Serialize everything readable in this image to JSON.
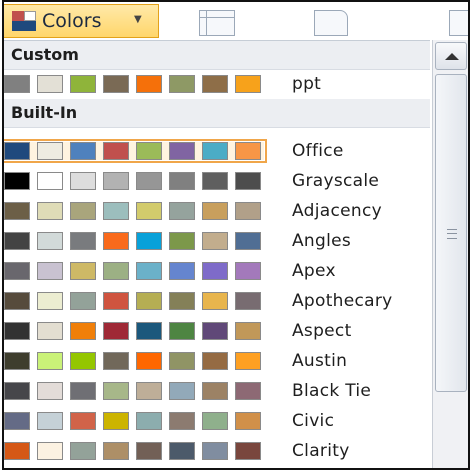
{
  "ribbon": {
    "colors_label": "Colors",
    "colors_caret": "▼"
  },
  "sections": {
    "custom": "Custom",
    "builtin": "Built-In"
  },
  "custom_themes": [
    {
      "name": "ppt",
      "colors": [
        "#808080",
        "#e3e0d6",
        "#8fb43a",
        "#7a6a55",
        "#f5700a",
        "#8e9965",
        "#8e6e48",
        "#f7a21b"
      ]
    }
  ],
  "builtin_themes": [
    {
      "name": "Office",
      "colors": [
        "#1f497d",
        "#eeece1",
        "#4f81bd",
        "#c0504d",
        "#9bbb59",
        "#8064a2",
        "#4bacc6",
        "#f79646"
      ]
    },
    {
      "name": "Grayscale",
      "colors": [
        "#000000",
        "#ffffff",
        "#dddddd",
        "#b2b2b2",
        "#969696",
        "#808080",
        "#5f5f5f",
        "#4d4d4d"
      ]
    },
    {
      "name": "Adjacency",
      "colors": [
        "#6c5f47",
        "#dfdcb7",
        "#a9a57c",
        "#9cbebd",
        "#d2cb6c",
        "#95a39d",
        "#c89f5d",
        "#b1a089"
      ]
    },
    {
      "name": "Angles",
      "colors": [
        "#434343",
        "#d2dad9",
        "#797b7e",
        "#f96a1b",
        "#08a1d9",
        "#7c984a",
        "#c2ad8d",
        "#506e94"
      ]
    },
    {
      "name": "Apex",
      "colors": [
        "#69676d",
        "#c9c2d1",
        "#ceb966",
        "#9cb084",
        "#6bb1c9",
        "#6585cf",
        "#7e6bc9",
        "#a379bb"
      ]
    },
    {
      "name": "Apothecary",
      "colors": [
        "#564b3c",
        "#ecedd1",
        "#93a299",
        "#cf543f",
        "#b5ae53",
        "#848058",
        "#e8b54d",
        "#786c71"
      ]
    },
    {
      "name": "Aspect",
      "colors": [
        "#323232",
        "#e3ded1",
        "#f07f09",
        "#9f2936",
        "#1b587c",
        "#4e8542",
        "#604878",
        "#c19859"
      ]
    },
    {
      "name": "Austin",
      "colors": [
        "#3e3d2d",
        "#caf278",
        "#94c600",
        "#71685a",
        "#ff6700",
        "#909465",
        "#956b43",
        "#fea022"
      ]
    },
    {
      "name": "Black Tie",
      "colors": [
        "#46464a",
        "#e3dcd8",
        "#6f6f74",
        "#a7b789",
        "#beae98",
        "#92a9b9",
        "#9c8265",
        "#8d6974"
      ]
    },
    {
      "name": "Civic",
      "colors": [
        "#646b86",
        "#c5d1d7",
        "#d16349",
        "#ccb400",
        "#8cadae",
        "#8c7b70",
        "#8fb08c",
        "#d19049"
      ]
    },
    {
      "name": "Clarity",
      "colors": [
        "#d55816",
        "#fcf2e2",
        "#93a299",
        "#ad8f67",
        "#726056",
        "#4c5a6a",
        "#808da0",
        "#79463d"
      ]
    }
  ]
}
